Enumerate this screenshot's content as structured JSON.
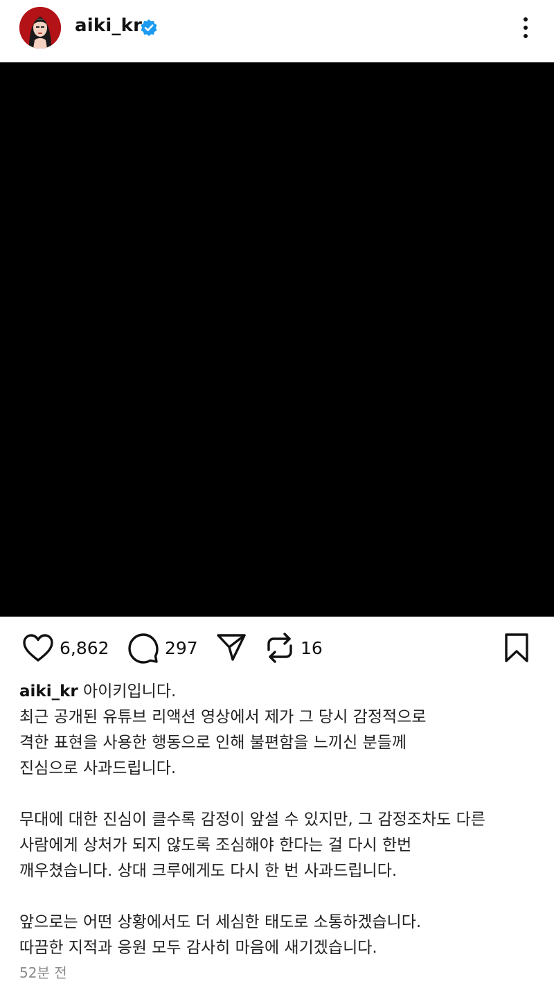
{
  "header": {
    "username": "aiki_kr",
    "verified_icon": "verified-badge-icon",
    "more_icon": "more-vertical-icon"
  },
  "media": {
    "background": "#000000"
  },
  "actions": {
    "like_icon": "heart-icon",
    "likes": "6,862",
    "comment_icon": "comment-icon",
    "comments": "297",
    "share_icon": "send-icon",
    "repost_icon": "repost-icon",
    "reposts": "16",
    "save_icon": "bookmark-icon"
  },
  "caption": {
    "username": "aiki_kr",
    "line1_rest": " 아이키입니다.",
    "line2": "최근 공개된 유튜브 리액션 영상에서 제가 그 당시 감정적으로",
    "line3": "격한 표현을 사용한 행동으로 인해 불편함을 느끼신 분들께",
    "line4": "진심으로 사과드립니다.",
    "line5": "무대에 대한 진심이 클수록 감정이 앞설 수 있지만, 그 감정조차도 다른",
    "line6": "사람에게 상처가 되지 않도록 조심해야 한다는 걸 다시 한번",
    "line7": "깨우쳤습니다. 상대 크루에게도 다시 한 번 사과드립니다.",
    "line8": "앞으로는 어떤 상황에서도 더 세심한 태도로 소통하겠습니다.",
    "line9": "따끔한 지적과 응원 모두 감사히 마음에 새기겠습니다."
  },
  "timestamp": "52분 전",
  "colors": {
    "verified": "#1d9bf0",
    "avatar_bg": "#b31217",
    "timestamp": "#8a8a8a"
  }
}
